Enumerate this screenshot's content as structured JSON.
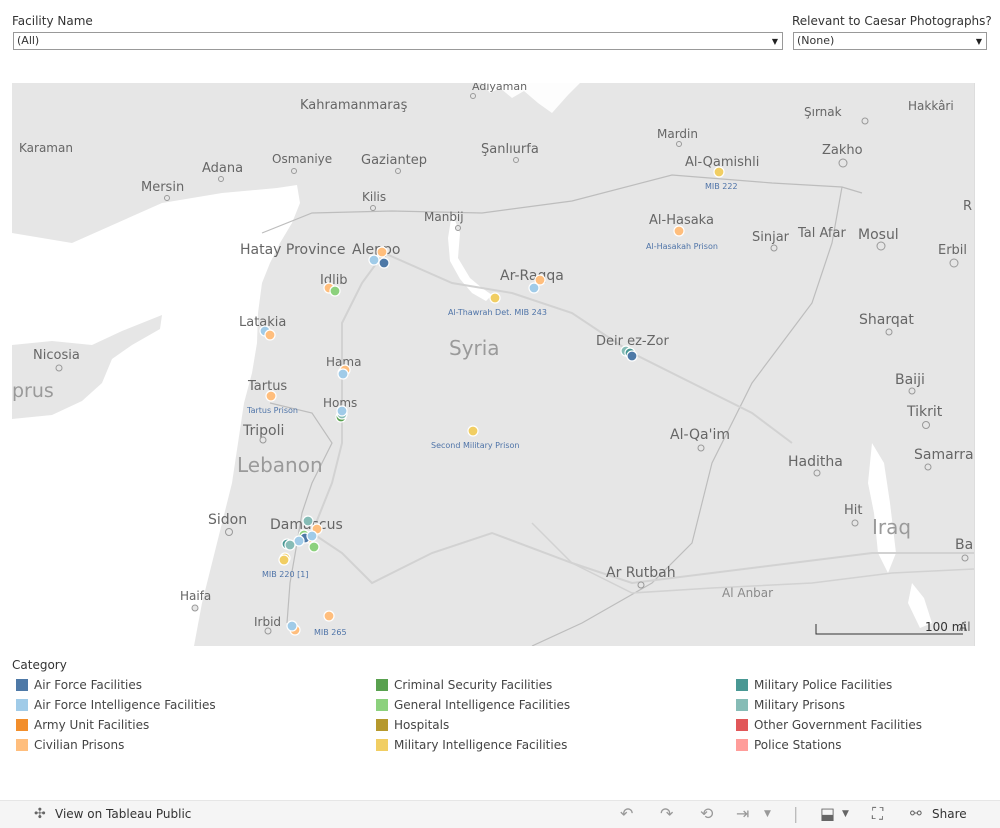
{
  "filters": {
    "facility": {
      "label": "Facility Name",
      "value": "(All)"
    },
    "caesar": {
      "label": "Relevant to Caesar Photographs?",
      "value": "(None)"
    }
  },
  "map": {
    "places": [
      "Adiyaman",
      "Kahramanmaraş",
      "Şırnak",
      "Hakkâri",
      "Mardin",
      "Karaman",
      "Adana",
      "Osmaniye",
      "Gaziantep",
      "Şanlıurfa",
      "Al-Qamishli",
      "Zakho",
      "Mersin",
      "Kilis",
      "Manbij",
      "Al-Hasaka",
      "Sinjar",
      "Tal Afar",
      "Mosul",
      "Erbil",
      "R",
      "Hatay Province",
      "Aleppo",
      "Idlib",
      "Ar-Raqqa",
      "Latakia",
      "Sharqat",
      "Nicosia",
      "Syria",
      "Hama",
      "Deir ez-Zor",
      "Baiji",
      "prus",
      "Tartus",
      "Homs",
      "Tikrit",
      "Tripoli",
      "Lebanon",
      "Al-Qa'im",
      "Haditha",
      "Samarra",
      "Sidon",
      "Damascus",
      "Hit",
      "Iraq",
      "Ba",
      "Ar Rutbah",
      "Haifa",
      "Al Anbar",
      "Irbid",
      "Al"
    ],
    "facility_labels": [
      "MIB 222",
      "Al-Hasakah Prison",
      "Al-Thawrah Det. MIB 243",
      "Tartus Prison",
      "Second Military Prison",
      "MIB 220 [1]",
      "MIB 265"
    ],
    "scale_label": "100 mi"
  },
  "legend": {
    "title": "Category",
    "items": [
      {
        "label": "Air Force Facilities",
        "color": "#4e79a7"
      },
      {
        "label": "Air Force Intelligence Facilities",
        "color": "#a0cbe8"
      },
      {
        "label": "Army Unit Facilities",
        "color": "#f28e2b"
      },
      {
        "label": "Civilian Prisons",
        "color": "#ffbe7d"
      },
      {
        "label": "Criminal Security Facilities",
        "color": "#59a14f"
      },
      {
        "label": "General Intelligence Facilities",
        "color": "#8cd17d"
      },
      {
        "label": "Hospitals",
        "color": "#b6992d"
      },
      {
        "label": "Military Intelligence Facilities",
        "color": "#f1ce63"
      },
      {
        "label": "Military Police Facilities",
        "color": "#499894"
      },
      {
        "label": "Military Prisons",
        "color": "#86bcb6"
      },
      {
        "label": "Other Government Facilities",
        "color": "#e15759"
      },
      {
        "label": "Police Stations",
        "color": "#ff9d9a"
      }
    ]
  },
  "footer": {
    "view_label": "View on Tableau Public",
    "share_label": "Share"
  }
}
